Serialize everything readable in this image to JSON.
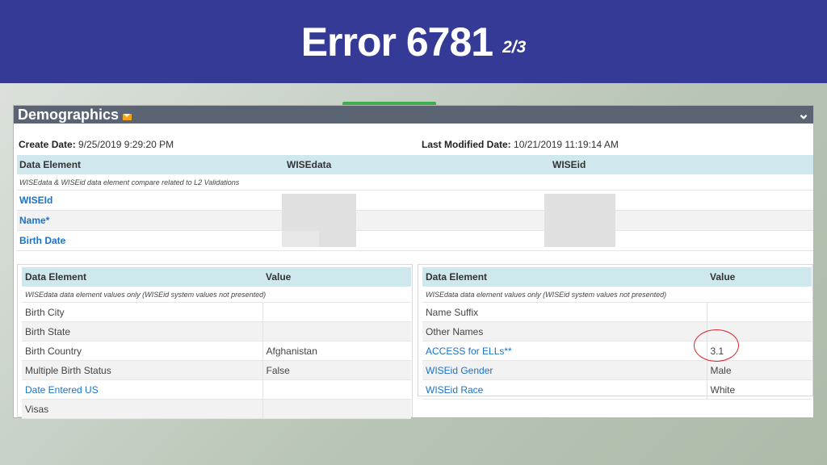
{
  "banner": {
    "title": "Error 6781",
    "page": "2/3",
    "bg": "#343a96"
  },
  "panel": {
    "title": "Demographics",
    "create_label": "Create Date:",
    "create_value": "9/25/2019 9:29:20 PM",
    "modified_label": "Last Modified Date:",
    "modified_value": "10/21/2019 11:19:14 AM"
  },
  "compare": {
    "headers": [
      "Data Element",
      "WISEdata",
      "WISEid"
    ],
    "note": "WISEdata & WISEid data element compare related to L2 Validations",
    "rows": [
      "WISEId",
      "Name*",
      "Birth Date"
    ]
  },
  "left_table": {
    "headers": [
      "Data Element",
      "Value"
    ],
    "note": "WISEdata data element values only (WISEid system values not presented)",
    "rows": [
      {
        "label": "Birth City",
        "value": "",
        "link": false
      },
      {
        "label": "Birth State",
        "value": "",
        "link": false
      },
      {
        "label": "Birth Country",
        "value": "Afghanistan",
        "link": false
      },
      {
        "label": "Multiple Birth Status",
        "value": "False",
        "link": false
      },
      {
        "label": "Date Entered US",
        "value": "",
        "link": true
      },
      {
        "label": "Visas",
        "value": "",
        "link": false
      }
    ]
  },
  "right_table": {
    "headers": [
      "Data Element",
      "Value"
    ],
    "note": "WISEdata data element values only (WISEid system values not presented)",
    "rows": [
      {
        "label": "Name Suffix",
        "value": "",
        "link": false
      },
      {
        "label": "Other Names",
        "value": "",
        "link": false
      },
      {
        "label": "ACCESS for ELLs**",
        "value": "3.1",
        "link": true
      },
      {
        "label": "WISEid Gender",
        "value": "Male",
        "link": true
      },
      {
        "label": "WISEid Race",
        "value": "White",
        "link": true
      }
    ]
  },
  "colors": {
    "header_bg": "#cfe8ee",
    "link": "#1a73c9",
    "highlight": "#d9262c"
  },
  "icons": {
    "mail": "mail-icon",
    "chevron": "chevron-down-icon"
  }
}
